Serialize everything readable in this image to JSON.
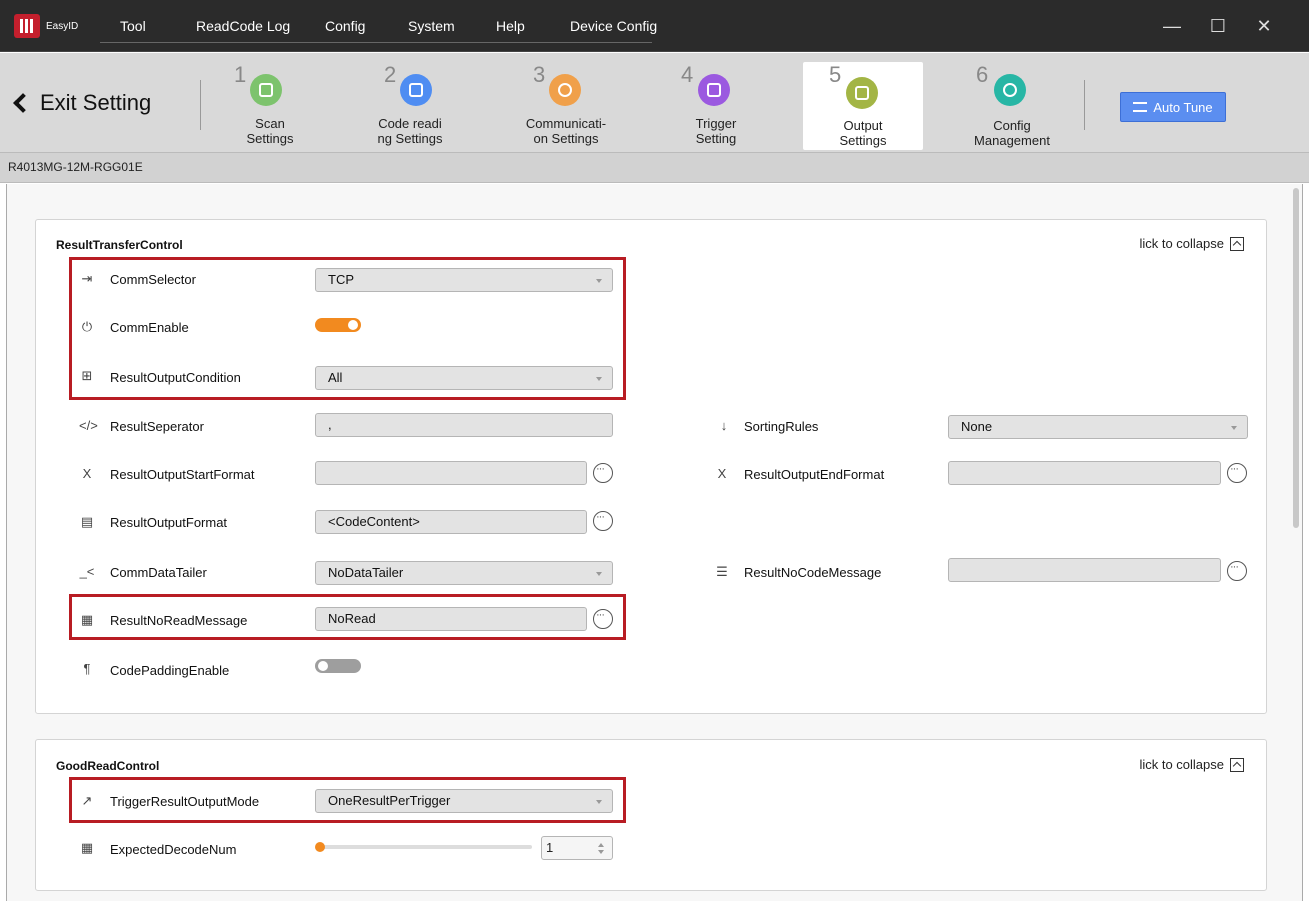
{
  "app": {
    "logo_text": "EasyID",
    "menu": [
      "Tool",
      "ReadCode Log",
      "Config",
      "System",
      "Help",
      "Device Config"
    ]
  },
  "toolbar": {
    "exit_label": "Exit Setting",
    "steps": [
      {
        "num": "1",
        "label": "Scan\nSettings",
        "color": "#7dc36d"
      },
      {
        "num": "2",
        "label": "Code readi\nng Settings",
        "color": "#4f8df2"
      },
      {
        "num": "3",
        "label": "Communicati-\non Settings",
        "color": "#f0a04a"
      },
      {
        "num": "4",
        "label": "Trigger\nSetting",
        "color": "#9b59e0"
      },
      {
        "num": "5",
        "label": "Output\nSettings",
        "color": "#a3b545"
      },
      {
        "num": "6",
        "label": "Config\nManagement",
        "color": "#27b6a5"
      }
    ],
    "auto_tune": "Auto Tune"
  },
  "device": {
    "model": "R4013MG-12M-RGG01E"
  },
  "panel1": {
    "title": "ResultTransferControl",
    "collapse": "lick to collapse",
    "rows": {
      "comm_selector": {
        "label": "CommSelector",
        "value": "TCP"
      },
      "comm_enable": {
        "label": "CommEnable",
        "on": true
      },
      "result_output_condition": {
        "label": "ResultOutputCondition",
        "value": "All"
      },
      "result_seperator": {
        "label": "ResultSeperator",
        "value": ","
      },
      "sorting_rules": {
        "label": "SortingRules",
        "value": "None"
      },
      "start_format": {
        "label": "ResultOutputStartFormat",
        "value": ""
      },
      "end_format": {
        "label": "ResultOutputEndFormat",
        "value": ""
      },
      "output_format": {
        "label": "ResultOutputFormat",
        "value": "<CodeContent>"
      },
      "comm_data_tailer": {
        "label": "CommDataTailer",
        "value": "NoDataTailer"
      },
      "no_code_message": {
        "label": "ResultNoCodeMessage",
        "value": ""
      },
      "no_read_message": {
        "label": "ResultNoReadMessage",
        "value": "NoRead"
      },
      "code_padding": {
        "label": "CodePaddingEnable",
        "on": false
      }
    }
  },
  "panel2": {
    "title": "GoodReadControl",
    "collapse": "lick to collapse",
    "rows": {
      "trigger_mode": {
        "label": "TriggerResultOutputMode",
        "value": "OneResultPerTrigger"
      },
      "expected_num": {
        "label": "ExpectedDecodeNum",
        "value": "1"
      }
    }
  },
  "colors": {
    "accent": "#f28a1f",
    "highlight": "#b81c23",
    "auto_tune": "#5b8ef0"
  }
}
